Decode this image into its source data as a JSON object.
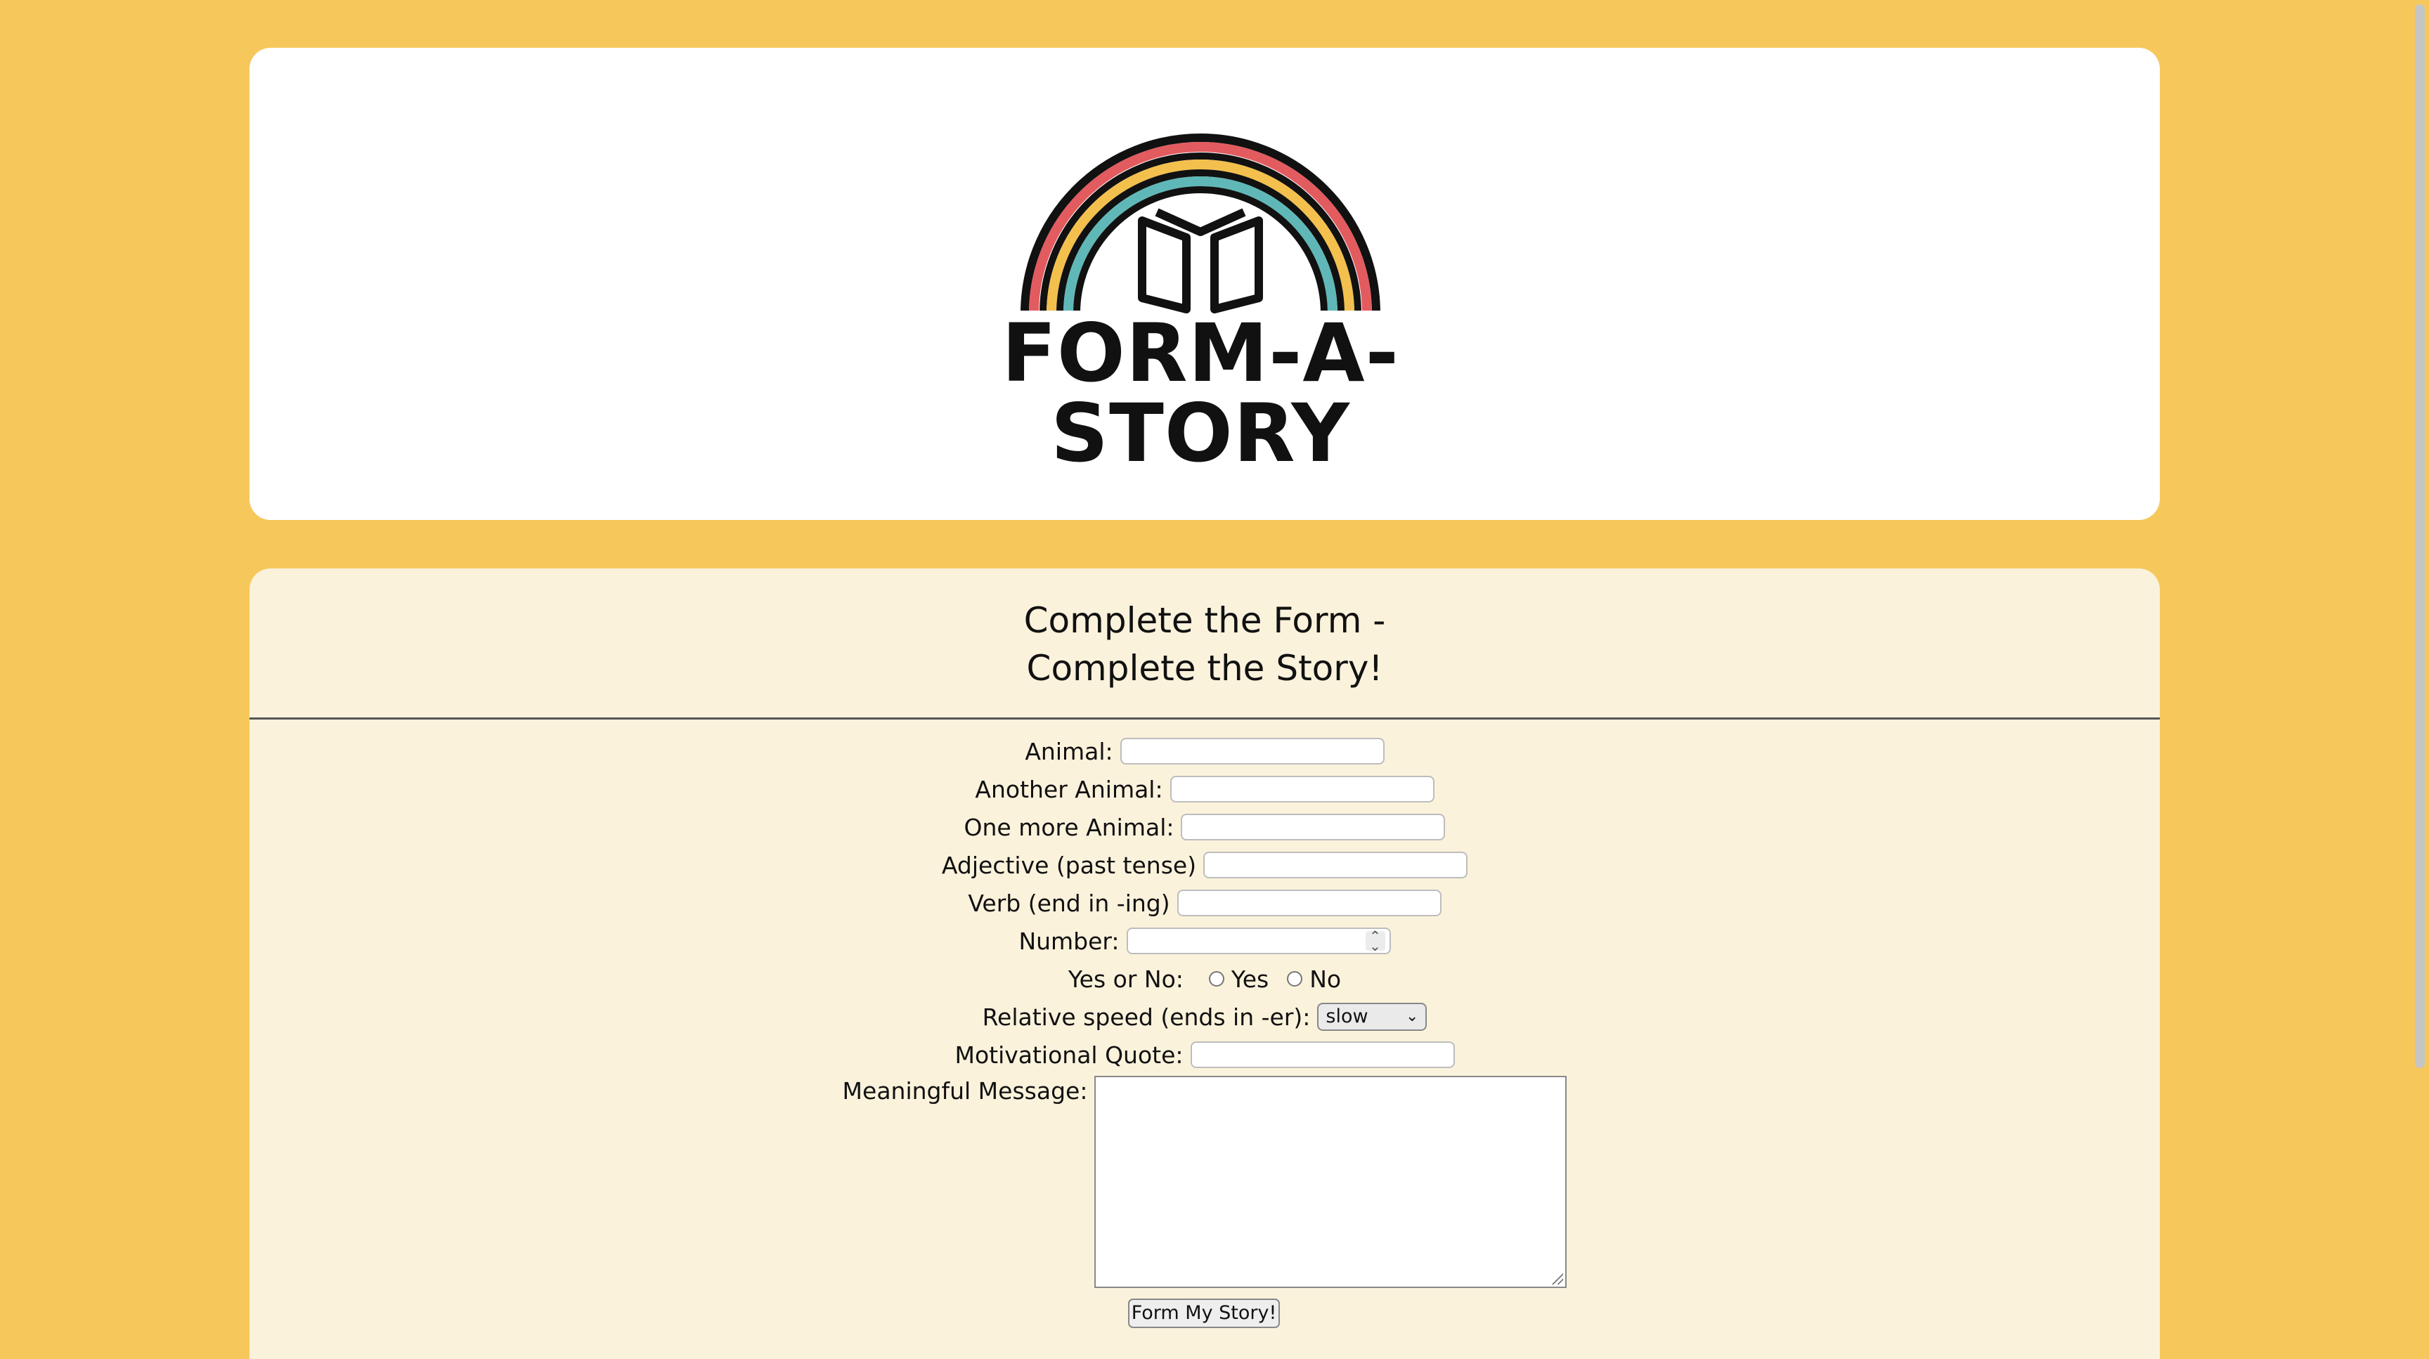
{
  "brand": {
    "name": "FORM-A-STORY",
    "colors": {
      "page_background": "#f6c85c",
      "header_background": "#ffffff",
      "form_background": "#fbf2dc",
      "rainbow_red": "#e25b5f",
      "rainbow_yellow": "#f3c04e",
      "rainbow_teal": "#5fb8b7"
    },
    "logo_icon": "rainbow-open-book-icon"
  },
  "form": {
    "title_line1": "Complete the Form -",
    "title_line2": "Complete the Story!",
    "fields": {
      "animal": {
        "label": "Animal:",
        "value": ""
      },
      "another_animal": {
        "label": "Another Animal:",
        "value": ""
      },
      "one_more_animal": {
        "label": "One more Animal:",
        "value": ""
      },
      "adjective": {
        "label": "Adjective (past tense)",
        "value": ""
      },
      "verb": {
        "label": "Verb (end in -ing)",
        "value": ""
      },
      "number": {
        "label": "Number:",
        "value": ""
      },
      "yes_no": {
        "label": "Yes or No:",
        "option_yes": "Yes",
        "option_no": "No"
      },
      "speed": {
        "label": "Relative speed (ends in -er):",
        "selected": "slow"
      },
      "quote": {
        "label": "Motivational Quote:",
        "value": ""
      },
      "message": {
        "label": "Meaningful Message:",
        "value": ""
      }
    },
    "submit_label": "Form My Story!"
  }
}
